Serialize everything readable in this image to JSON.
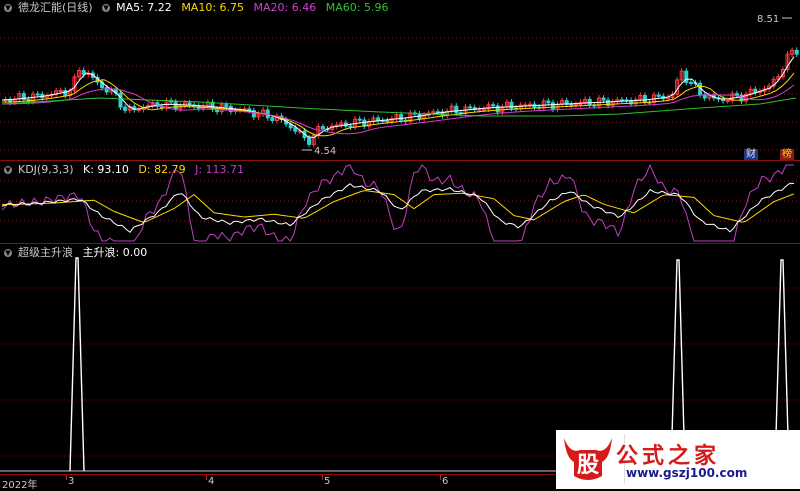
{
  "main_panel": {
    "title": "德龙汇能(日线)",
    "ma": [
      {
        "label": "MA5: 7.22",
        "color": "#ffffff"
      },
      {
        "label": "MA10: 6.75",
        "color": "#ffd700"
      },
      {
        "label": "MA20: 6.46",
        "color": "#d040d0"
      },
      {
        "label": "MA60: 5.96",
        "color": "#30c030"
      }
    ],
    "high_label": "8.51",
    "low_label": "4.54",
    "badge_left": "财",
    "badge_right": "榜"
  },
  "kdj_panel": {
    "title": "KDJ(9,3,3)",
    "k": "K: 93.10",
    "d": "D: 82.79",
    "j": "J: 113.71"
  },
  "signal_panel": {
    "title": "超级主升浪",
    "value": "主升浪: 0.00"
  },
  "x_axis": {
    "labels": [
      "2022年",
      "3",
      "4",
      "5",
      "6"
    ]
  },
  "watermark": {
    "text": "公式之家",
    "url": "www.gszj100.com",
    "logo": "股"
  },
  "colors": {
    "up": "#ff3c3c",
    "down": "#30d0d0",
    "grid": "#8b0f0f",
    "k_line": "#ffffff",
    "d_line": "#ffd700",
    "j_line": "#c040c0"
  }
}
